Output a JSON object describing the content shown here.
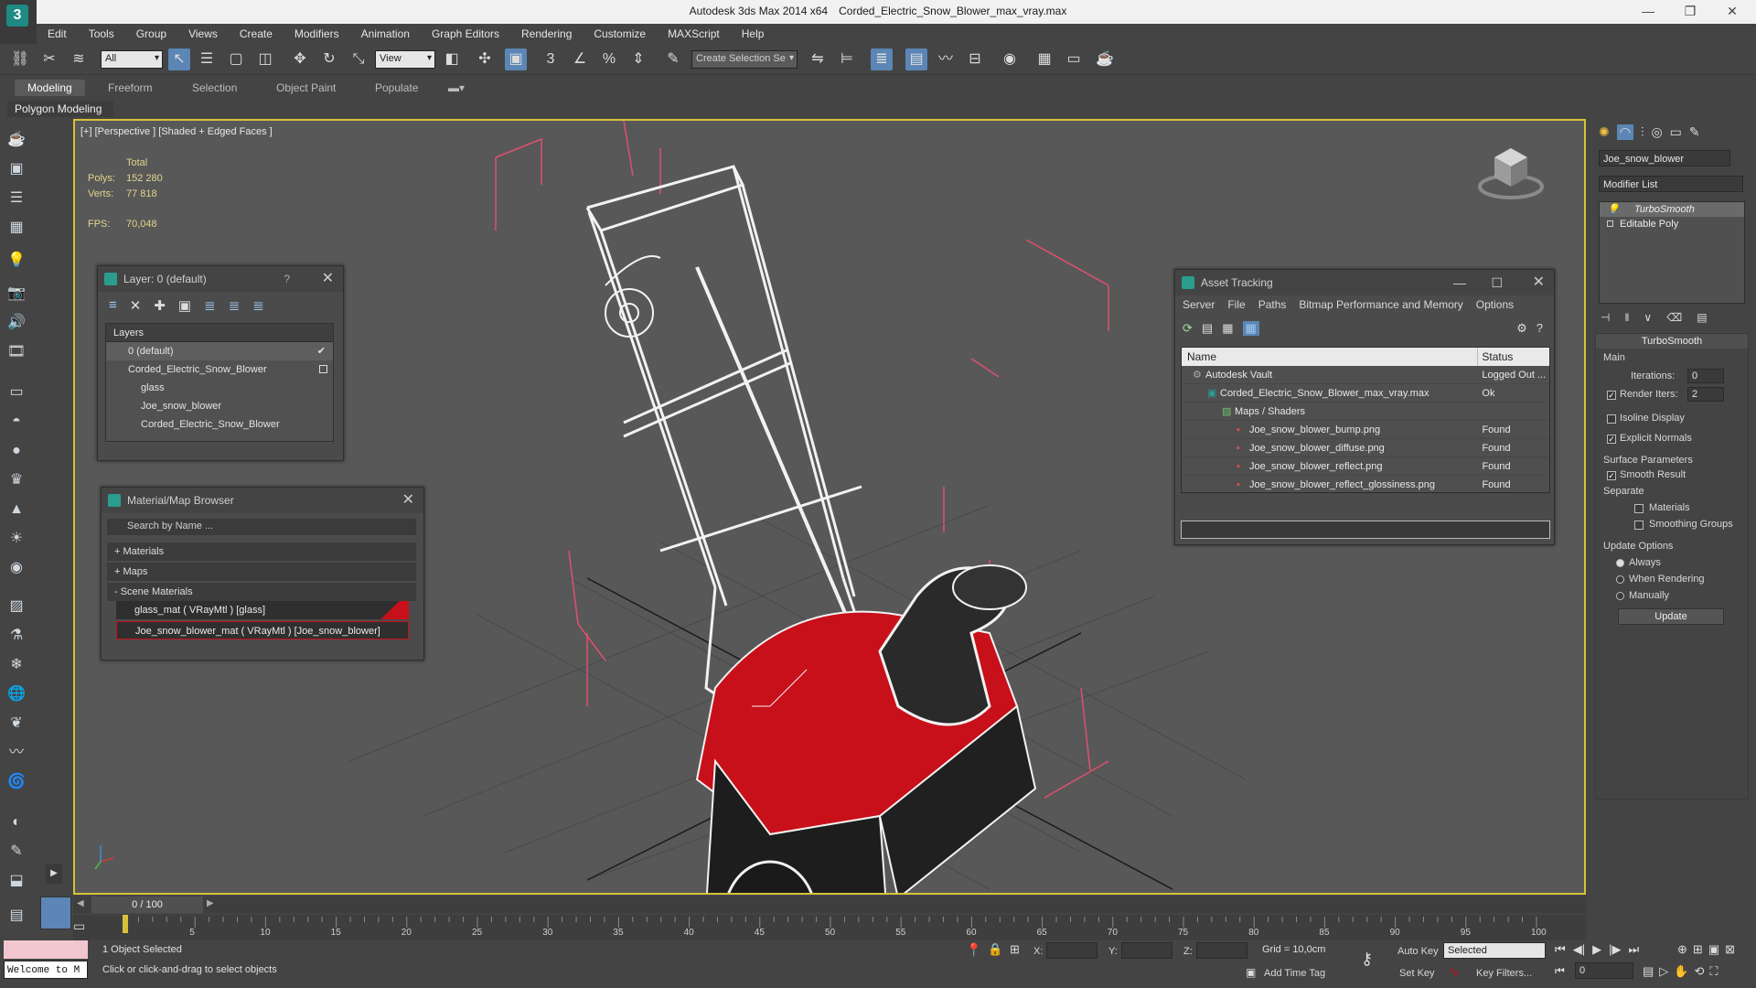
{
  "titlebar": {
    "app": "Autodesk 3ds Max  2014 x64",
    "file": "Corded_Electric_Snow_Blower_max_vray.max"
  },
  "menu": [
    "Edit",
    "Tools",
    "Group",
    "Views",
    "Create",
    "Modifiers",
    "Animation",
    "Graph Editors",
    "Rendering",
    "Customize",
    "MAXScript",
    "Help"
  ],
  "toolbar": {
    "filter_value": "All",
    "refcoord_value": "View",
    "selection_set_placeholder": "Create Selection Se"
  },
  "ribbon": {
    "tabs": [
      "Modeling",
      "Freeform",
      "Selection",
      "Object Paint",
      "Populate"
    ],
    "panel_label": "Polygon Modeling"
  },
  "viewport": {
    "label": "[+] [Perspective ] [Shaded + Edged Faces ]",
    "stats": {
      "total_label": "Total",
      "polys_label": "Polys:",
      "polys": "152 280",
      "verts_label": "Verts:",
      "verts": "77 818",
      "fps_label": "FPS:",
      "fps": "70,048"
    }
  },
  "layer_panel": {
    "title": "Layer: 0 (default)",
    "help": "?",
    "header": "Layers",
    "rows": [
      "0 (default)",
      "Corded_Electric_Snow_Blower",
      "glass",
      "Joe_snow_blower",
      "Corded_Electric_Snow_Blower"
    ]
  },
  "material_browser": {
    "title": "Material/Map Browser",
    "search_placeholder": "Search by Name ...",
    "sections": [
      "+ Materials",
      "+ Maps",
      "- Scene Materials"
    ],
    "scene_materials": [
      "glass_mat  ( VRayMtl ) [glass]",
      "Joe_snow_blower_mat  ( VRayMtl ) [Joe_snow_blower]"
    ]
  },
  "asset_tracking": {
    "title": "Asset Tracking",
    "menu": [
      "Server",
      "File",
      "Paths",
      "Bitmap Performance and Memory",
      "Options"
    ],
    "columns": {
      "name": "Name",
      "status": "Status"
    },
    "rows": [
      {
        "name": "Autodesk Vault",
        "status": "Logged Out ..."
      },
      {
        "name": "Corded_Electric_Snow_Blower_max_vray.max",
        "status": "Ok"
      },
      {
        "name": "Maps / Shaders",
        "status": ""
      },
      {
        "name": "Joe_snow_blower_bump.png",
        "status": "Found"
      },
      {
        "name": "Joe_snow_blower_diffuse.png",
        "status": "Found"
      },
      {
        "name": "Joe_snow_blower_reflect.png",
        "status": "Found"
      },
      {
        "name": "Joe_snow_blower_reflect_glossiness.png",
        "status": "Found"
      }
    ]
  },
  "command_panel": {
    "object_name": "Joe_snow_blower",
    "modifier_list": "Modifier List",
    "stack": [
      "TurboSmooth",
      "Editable Poly"
    ],
    "rollout_title": "TurboSmooth",
    "main_label": "Main",
    "iterations_label": "Iterations:",
    "iterations": "0",
    "render_iters_label": "Render Iters:",
    "render_iters": "2",
    "isoline": "Isoline Display",
    "explicit_normals": "Explicit Normals",
    "surface_params": "Surface Parameters",
    "smooth_result": "Smooth Result",
    "separate": "Separate",
    "materials": "Materials",
    "smoothing_groups": "Smoothing Groups",
    "update_options": "Update Options",
    "always": "Always",
    "when_rendering": "When Rendering",
    "manually": "Manually",
    "update_button": "Update"
  },
  "timeline": {
    "frame": "0 / 100",
    "ticks": [
      "5",
      "10",
      "15",
      "20",
      "25",
      "30",
      "35",
      "40",
      "45",
      "50",
      "55",
      "60",
      "65",
      "70",
      "75",
      "80",
      "85",
      "90",
      "95",
      "100"
    ]
  },
  "status": {
    "welcome": "Welcome to M",
    "selection": "1 Object Selected",
    "prompt": "Click or click-and-drag to select objects",
    "x_label": "X:",
    "y_label": "Y:",
    "z_label": "Z:",
    "grid": "Grid = 10,0cm",
    "add_time_tag": "Add Time Tag",
    "auto_key": "Auto Key",
    "set_key": "Set Key",
    "selected": "Selected",
    "key_filters": "Key Filters...",
    "frame_field": "0"
  },
  "colors": {
    "viewport_border": "#d6c23a",
    "blower_red": "#c8101a",
    "bbox_pink": "#e0506e",
    "app_teal": "#1e8a84"
  }
}
